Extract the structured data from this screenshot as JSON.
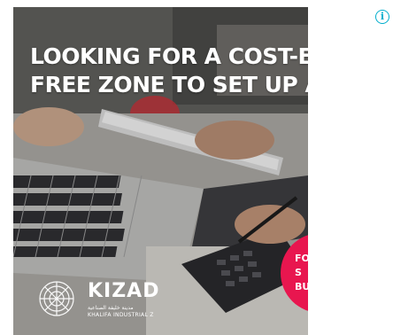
{
  "ad": {
    "headline_line1": "LOOKING FOR A COST-EFFE",
    "headline_line2": "FREE ZONE TO SET UP A BUS",
    "badge_line1": "FO",
    "badge_line2": "S",
    "badge_line3": "BU",
    "logo_name": "KIZAD",
    "logo_arabic": "مدينة خليفة الصناعية",
    "logo_sub": "KHALIFA INDUSTRIAL Z",
    "brand_color": "#e8164f"
  },
  "adchoices": {
    "icon": "info-icon",
    "glyph": "i",
    "color": "#00aecd"
  }
}
